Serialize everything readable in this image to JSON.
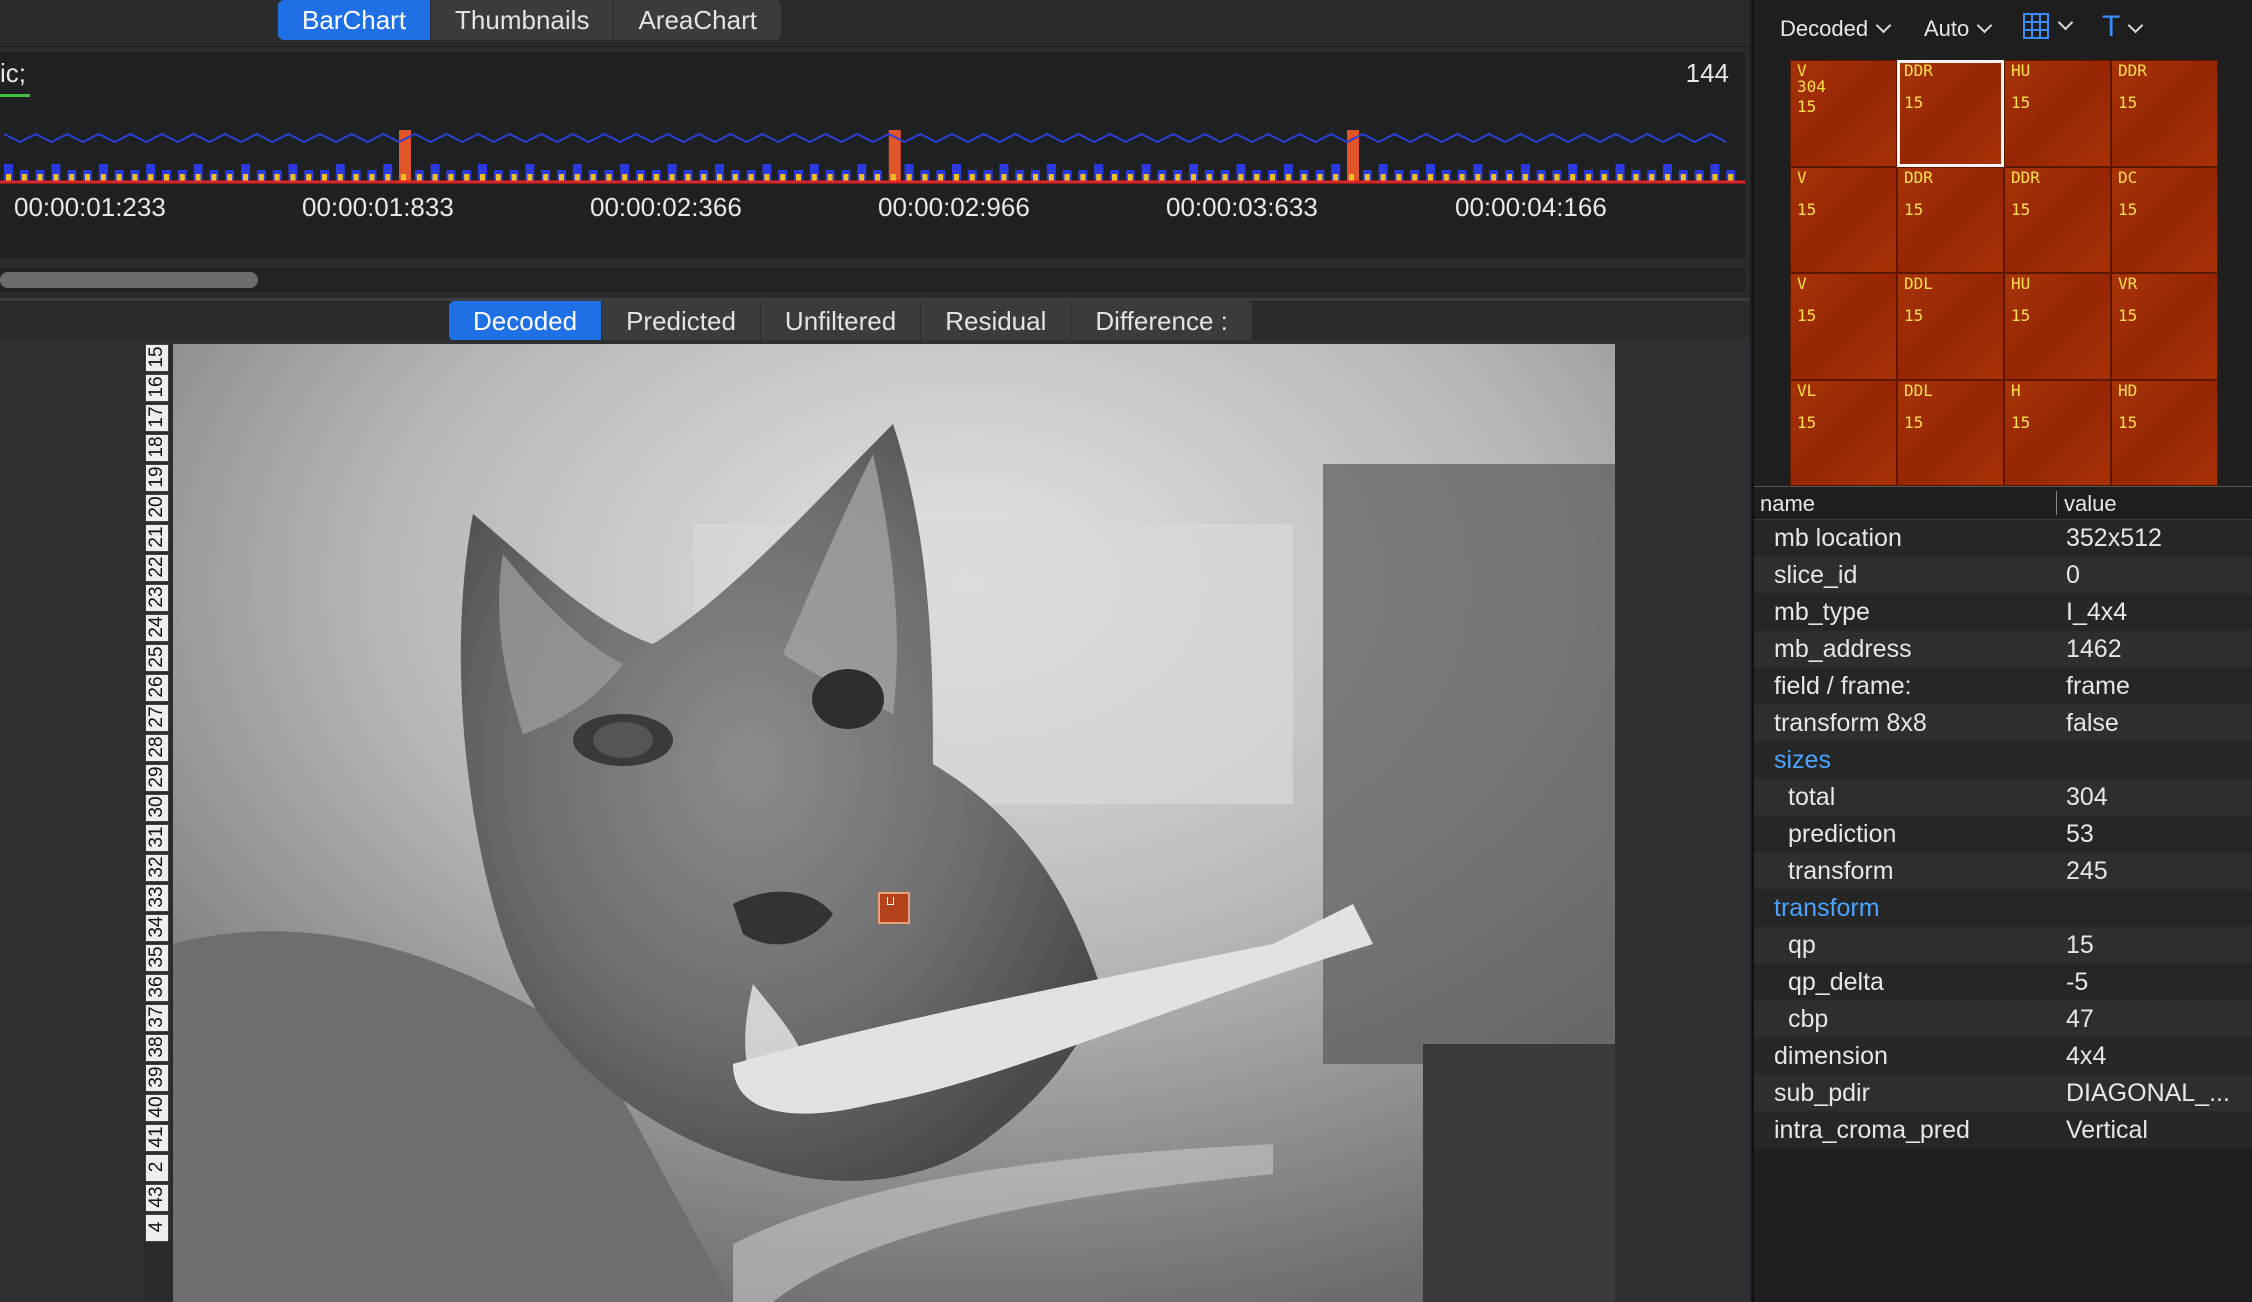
{
  "top_tabs": [
    "BarChart",
    "Thumbnails",
    "AreaChart"
  ],
  "chart": {
    "label": "ic;",
    "count": "144",
    "time_ticks": [
      "00:00:01:233",
      "00:00:01:833",
      "00:00:02:366",
      "00:00:02:966",
      "00:00:03:633",
      "00:00:04:166"
    ],
    "colors": {
      "line": "#2c3fd6",
      "bar": "#2b39e0",
      "inner": "#f0c020",
      "base": "#e02424",
      "keyframe": "#e2542a"
    }
  },
  "view_tabs": [
    "Decoded",
    "Predicted",
    "Unfiltered",
    "Residual",
    "Difference :"
  ],
  "ruler_labels": [
    "15",
    "16",
    "17",
    "18",
    "19",
    "20",
    "21",
    "22",
    "23",
    "24",
    "25",
    "26",
    "27",
    "28",
    "29",
    "30",
    "31",
    "32",
    "33",
    "34",
    "35",
    "36",
    "37",
    "38",
    "39",
    "40",
    "41",
    "2",
    "43",
    "4"
  ],
  "toolbar": {
    "mode": "Decoded",
    "scale": "Auto",
    "grid_icon": "grid-icon",
    "text_icon": "T"
  },
  "grid_cells": [
    {
      "mode": "V",
      "extra": "304",
      "qp": "15"
    },
    {
      "mode": "DDR",
      "qp": "15",
      "selected": true
    },
    {
      "mode": "HU",
      "qp": "15"
    },
    {
      "mode": "DDR",
      "qp": "15"
    },
    {
      "mode": "V",
      "qp": "15"
    },
    {
      "mode": "DDR",
      "qp": "15"
    },
    {
      "mode": "DDR",
      "qp": "15"
    },
    {
      "mode": "DC",
      "qp": "15"
    },
    {
      "mode": "V",
      "qp": "15"
    },
    {
      "mode": "DDL",
      "qp": "15"
    },
    {
      "mode": "HU",
      "qp": "15"
    },
    {
      "mode": "VR",
      "qp": "15"
    },
    {
      "mode": "VL",
      "qp": "15"
    },
    {
      "mode": "DDL",
      "qp": "15"
    },
    {
      "mode": "H",
      "qp": "15"
    },
    {
      "mode": "HD",
      "qp": "15"
    }
  ],
  "table": {
    "header": {
      "name": "name",
      "value": "value"
    },
    "rows": [
      {
        "name": "mb location",
        "value": "352x512"
      },
      {
        "name": "slice_id",
        "value": "0"
      },
      {
        "name": "mb_type",
        "value": "I_4x4"
      },
      {
        "name": "mb_address",
        "value": "1462"
      },
      {
        "name": "field / frame:",
        "value": "frame"
      },
      {
        "name": "transform 8x8",
        "value": "false"
      },
      {
        "name": "sizes",
        "value": "",
        "section": true
      },
      {
        "name": "total",
        "value": "304",
        "indent": true
      },
      {
        "name": "prediction",
        "value": "53",
        "indent": true
      },
      {
        "name": "transform",
        "value": "245",
        "indent": true
      },
      {
        "name": "transform",
        "value": "",
        "section": true
      },
      {
        "name": "qp",
        "value": "15",
        "indent": true
      },
      {
        "name": "qp_delta",
        "value": "-5",
        "indent": true
      },
      {
        "name": "cbp",
        "value": "47",
        "indent": true
      },
      {
        "name": "dimension",
        "value": "4x4"
      },
      {
        "name": "sub_pdir",
        "value": "DIAGONAL_..."
      },
      {
        "name": "intra_croma_pred",
        "value": "Vertical"
      }
    ]
  }
}
